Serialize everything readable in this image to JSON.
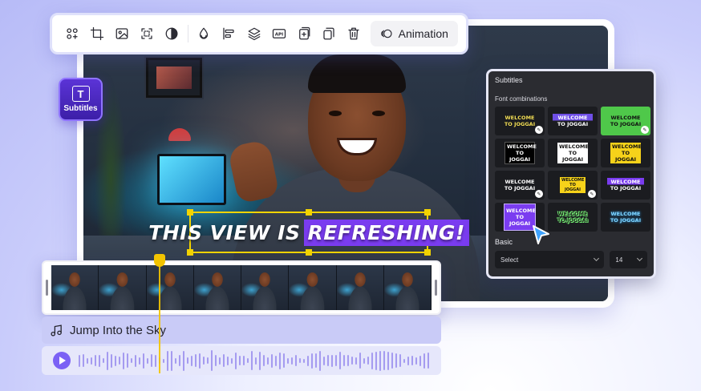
{
  "toolbar": {
    "tools": [
      "connect-icon",
      "crop-icon",
      "image-icon",
      "frame-icon",
      "contrast-icon",
      "drop-icon",
      "align-icon",
      "layers-icon",
      "api-icon",
      "add-icon",
      "duplicate-icon",
      "delete-icon"
    ],
    "api_label": "API",
    "animation_label": "Animation"
  },
  "subtitles_badge": {
    "label": "Subtitles",
    "icon_letter": "T"
  },
  "caption": {
    "text_plain": "THIS VIEW IS",
    "text_highlight": "REFRESHING!"
  },
  "panel": {
    "title": "Subtitles",
    "section_label": "Font combinations",
    "presets": [
      {
        "text": "WELCOME TO JOGGAI",
        "style": "yellow-white-bold"
      },
      {
        "text": "WELCOME TO JOGGAI",
        "style": "purple-label"
      },
      {
        "text": "WELCOME TO JOGGAI",
        "style": "green-bg"
      },
      {
        "text": "WELCOME TO JOGGAI",
        "style": "black-box"
      },
      {
        "text": "WELCOME TO JOGGAI",
        "style": "white-box"
      },
      {
        "text": "WELCOME TO JOGGAI",
        "style": "yellow-box"
      },
      {
        "text": "WELCOME TO JOGGAI",
        "style": "purple-white"
      },
      {
        "text": "WELCOME TO JOGGAI",
        "style": "yellow-strip"
      },
      {
        "text": "WELCOME TO JOGGAI",
        "style": "purple-strip"
      },
      {
        "text": "WELCOME TO JOGGAI",
        "style": "purple-selected"
      },
      {
        "text": "WELCOME TO JOGGAI",
        "style": "green-outline"
      },
      {
        "text": "WELCOME TO JOGGAI",
        "style": "blue-glow"
      }
    ],
    "basic_label": "Basic",
    "font_select": "Select",
    "size_select": "14"
  },
  "timeline": {
    "frame_count": 8,
    "audio_title": "Jump Into the Sky"
  },
  "colors": {
    "accent": "#7a3cf0",
    "caption_border": "#f3d400",
    "panel_bg": "#2b2c31"
  }
}
